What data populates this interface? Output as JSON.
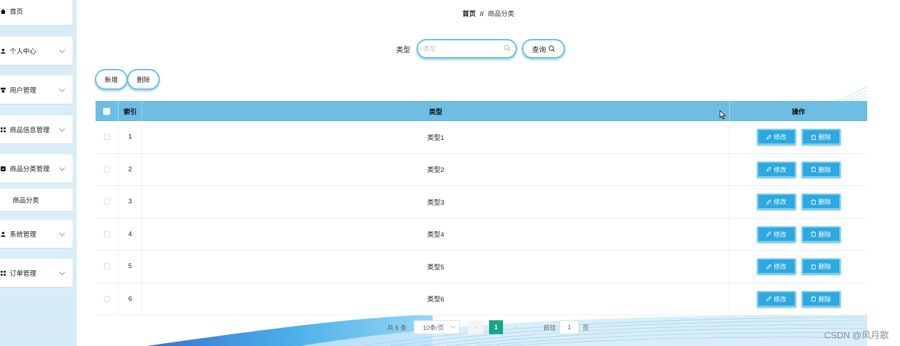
{
  "sidebar": {
    "items": [
      {
        "label": "首页",
        "icon": "home-icon",
        "has_chevron": false
      },
      {
        "label": "个人中心",
        "icon": "user-icon",
        "has_chevron": true
      },
      {
        "label": "用户管理",
        "icon": "users-manage-icon",
        "has_chevron": true
      },
      {
        "label": "商品信息管理",
        "icon": "grid-icon",
        "has_chevron": true
      },
      {
        "label": "商品分类管理",
        "icon": "check-square-icon",
        "has_chevron": true
      },
      {
        "label": "商品分类",
        "icon": "",
        "has_chevron": false,
        "submenu": true
      },
      {
        "label": "系统管理",
        "icon": "user-icon",
        "has_chevron": true
      },
      {
        "label": "订单管理",
        "icon": "grid-icon",
        "has_chevron": true
      }
    ]
  },
  "breadcrumb": {
    "home": "首页",
    "separator": "//",
    "current": "商品分类"
  },
  "search": {
    "label": "类型",
    "placeholder": "类型",
    "query_label": "查询"
  },
  "actions": {
    "add_label": "新增",
    "delete_label": "删除"
  },
  "table": {
    "headers": {
      "index": "索引",
      "type": "类型",
      "ops": "操作"
    },
    "rows": [
      {
        "index": "1",
        "type": "类型1"
      },
      {
        "index": "2",
        "type": "类型2"
      },
      {
        "index": "3",
        "type": "类型3"
      },
      {
        "index": "4",
        "type": "类型4"
      },
      {
        "index": "5",
        "type": "类型5"
      },
      {
        "index": "6",
        "type": "类型6"
      }
    ],
    "edit_label": "修改",
    "delete_label": "删除"
  },
  "pagination": {
    "total_text": "共 6 条",
    "page_size": "10条/页",
    "current_page": "1",
    "goto_label": "前往",
    "goto_value": "1",
    "page_suffix": "页"
  },
  "watermark": "CSDN @风月歌",
  "colors": {
    "header_blue": "#6dbde4",
    "button_blue": "#2da8e0",
    "active_page": "#17a589"
  }
}
